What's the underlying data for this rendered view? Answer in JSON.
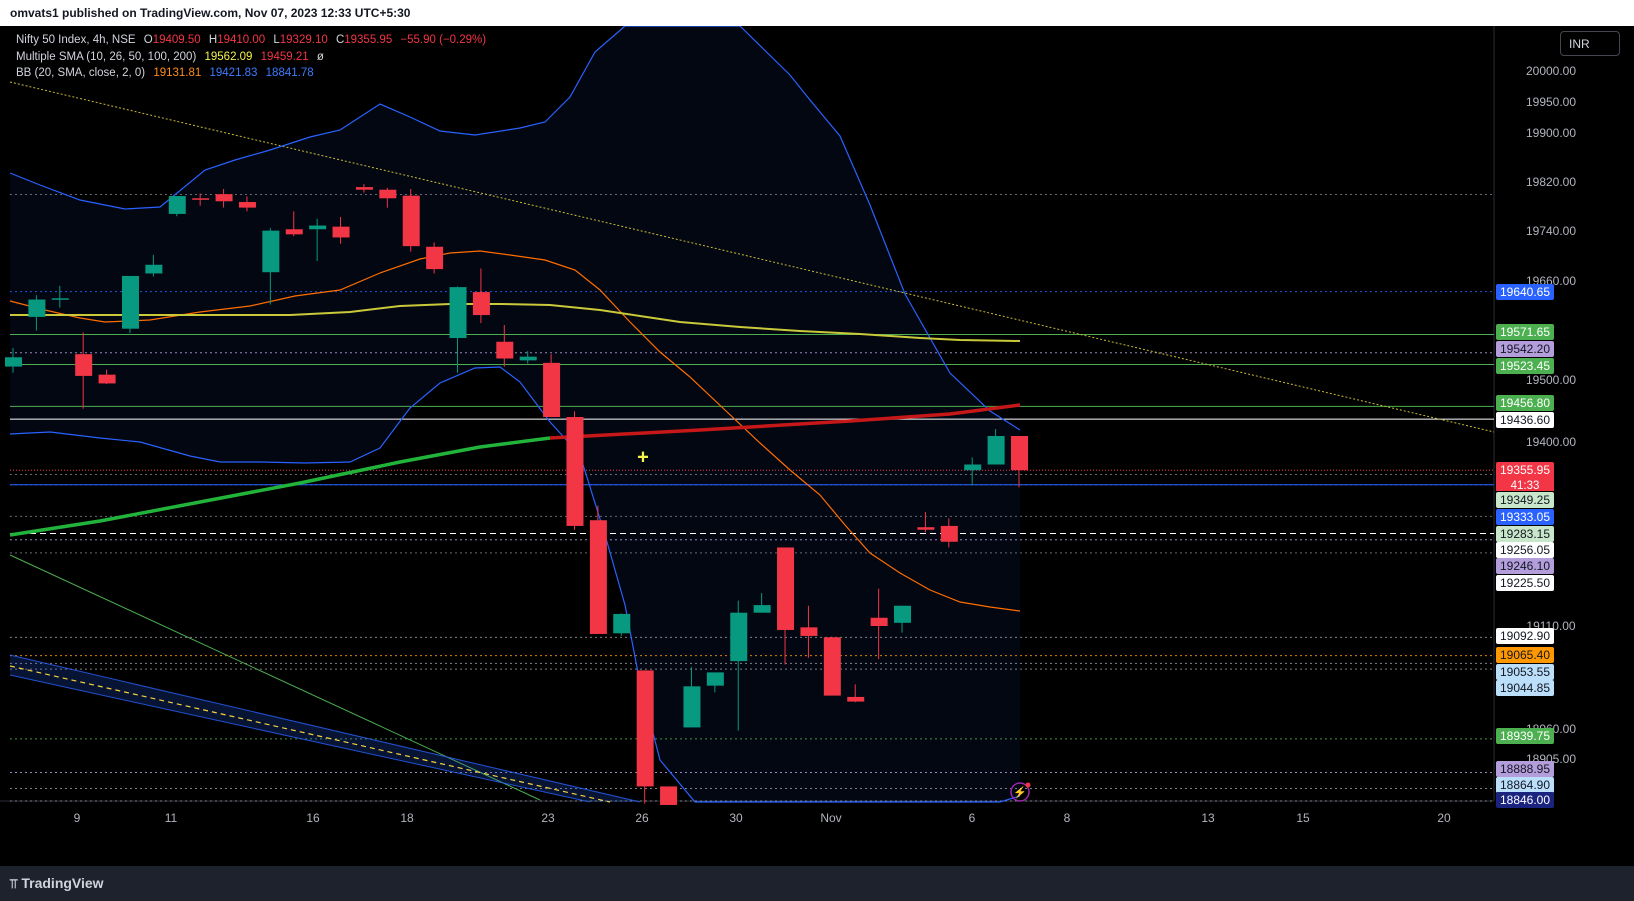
{
  "header": {
    "published": "omvats1 published on TradingView.com, Nov 07, 2023 12:33 UTC+5:30"
  },
  "currency_button": "INR",
  "footer": {
    "logo": "TradingView"
  },
  "legend": {
    "symbol": "Nifty 50 Index, 4h, NSE",
    "o_label": "O",
    "o": "19409.50",
    "h_label": "H",
    "h": "19410.00",
    "l_label": "L",
    "l": "19329.10",
    "c_label": "C",
    "c": "19355.95",
    "change": "−55.90 (−0.29%)",
    "sma_title": "Multiple SMA (10, 26, 50, 100, 200)",
    "sma_v1": "19562.09",
    "sma_v2": "19459.21",
    "sma_v3": "ø",
    "bb_title": "BB (20, SMA, close, 2, 0)",
    "bb_basis": "19131.81",
    "bb_upper": "19421.83",
    "bb_lower": "18841.78"
  },
  "chart_data": {
    "type": "candlestick",
    "title": "Nifty 50 Index, 4h, NSE",
    "x_tick_labels": [
      "9",
      "11",
      "16",
      "18",
      "23",
      "26",
      "30",
      "Nov",
      "6",
      "8",
      "13",
      "15",
      "20"
    ],
    "y_tick_labels": [
      "20000.00",
      "19950.00",
      "19900.00",
      "19820.00",
      "19740.00",
      "19660.00",
      "19500.00",
      "19400.00",
      "19110.00",
      "18960.00",
      "18905.00"
    ],
    "ylim": [
      18846,
      20040
    ],
    "candles": [
      {
        "o": 19520,
        "h": 19550,
        "l": 19510,
        "c": 19535
      },
      {
        "o": 19600,
        "h": 19635,
        "l": 19578,
        "c": 19628
      },
      {
        "o": 19630,
        "h": 19650,
        "l": 19615,
        "c": 19630
      },
      {
        "o": 19540,
        "h": 19575,
        "l": 19453,
        "c": 19505
      },
      {
        "o": 19507,
        "h": 19515,
        "l": 19492,
        "c": 19493
      },
      {
        "o": 19581,
        "h": 19665,
        "l": 19574,
        "c": 19666
      },
      {
        "o": 19670,
        "h": 19700,
        "l": 19665,
        "c": 19684
      },
      {
        "o": 19783,
        "h": 19830,
        "l": 19777,
        "c": 19831
      },
      {
        "o": 19825,
        "h": 19838,
        "l": 19805,
        "c": 19822
      },
      {
        "o": 19836,
        "h": 19850,
        "l": 19800,
        "c": 19817
      },
      {
        "o": 19815,
        "h": 19830,
        "l": 19790,
        "c": 19800
      },
      {
        "o": 19672,
        "h": 19745,
        "l": 19620,
        "c": 19739
      },
      {
        "o": 19742,
        "h": 19790,
        "l": 19730,
        "c": 19733
      },
      {
        "o": 19742,
        "h": 19770,
        "l": 19690,
        "c": 19752
      },
      {
        "o": 19749,
        "h": 19775,
        "l": 19718,
        "c": 19728
      },
      {
        "o": 19855,
        "h": 19863,
        "l": 19840,
        "c": 19848
      },
      {
        "o": 19848,
        "h": 19853,
        "l": 19800,
        "c": 19825
      },
      {
        "o": 19832,
        "h": 19850,
        "l": 19705,
        "c": 19714
      },
      {
        "o": 19713,
        "h": 19720,
        "l": 19670,
        "c": 19677
      },
      {
        "o": 19566,
        "h": 19649,
        "l": 19510,
        "c": 19648
      },
      {
        "o": 19640,
        "h": 19678,
        "l": 19590,
        "c": 19603
      },
      {
        "o": 19560,
        "h": 19587,
        "l": 19520,
        "c": 19533
      },
      {
        "o": 19530,
        "h": 19545,
        "l": 19525,
        "c": 19536
      },
      {
        "o": 19526,
        "h": 19540,
        "l": 19440,
        "c": 19440
      },
      {
        "o": 19440,
        "h": 19449,
        "l": 19262,
        "c": 19268
      },
      {
        "o": 19277,
        "h": 19300,
        "l": 19098,
        "c": 19098
      },
      {
        "o": 19099,
        "h": 19130,
        "l": 19095,
        "c": 19129
      },
      {
        "o": 19043,
        "h": 19043,
        "l": 18842,
        "c": 18868
      },
      {
        "o": 18868,
        "h": 18868,
        "l": 18840,
        "c": 18840
      },
      {
        "o": 18957,
        "h": 19048,
        "l": 18957,
        "c": 19019
      },
      {
        "o": 19020,
        "h": 19040,
        "l": 19010,
        "c": 19040
      },
      {
        "o": 19057,
        "h": 19150,
        "l": 18952,
        "c": 19131
      },
      {
        "o": 19131,
        "h": 19162,
        "l": 19131,
        "c": 19143
      },
      {
        "o": 19234,
        "h": 19234,
        "l": 19052,
        "c": 19104
      },
      {
        "o": 19108,
        "h": 19142,
        "l": 19062,
        "c": 19095
      },
      {
        "o": 19093,
        "h": 19094,
        "l": 19005,
        "c": 19005
      },
      {
        "o": 19003,
        "h": 19022,
        "l": 18995,
        "c": 18996
      },
      {
        "o": 19123,
        "h": 19169,
        "l": 19060,
        "c": 19110
      },
      {
        "o": 19115,
        "h": 19142,
        "l": 19100,
        "c": 19142
      },
      {
        "o": 19266,
        "h": 19290,
        "l": 19258,
        "c": 19262
      },
      {
        "o": 19268,
        "h": 19280,
        "l": 19234,
        "c": 19243
      },
      {
        "o": 19356,
        "h": 19376,
        "l": 19332,
        "c": 19365
      },
      {
        "o": 19365,
        "h": 19421,
        "l": 19365,
        "c": 19410
      },
      {
        "o": 19410,
        "h": 19410,
        "l": 19329,
        "c": 19356
      }
    ],
    "price_labels": [
      {
        "value": "19640.65",
        "bg": "#2962ff",
        "fg": "#ffffff"
      },
      {
        "value": "19571.65",
        "bg": "#4caf50",
        "fg": "#ffffff"
      },
      {
        "value": "19542.20",
        "bg": "#b39ddb",
        "fg": "#131722"
      },
      {
        "value": "19523.45",
        "bg": "#4caf50",
        "fg": "#ffffff"
      },
      {
        "value": "19456.80",
        "bg": "#4caf50",
        "fg": "#ffffff"
      },
      {
        "value": "19436.60",
        "bg": "#ffffff",
        "fg": "#131722"
      },
      {
        "value": "19355.95",
        "bg": "#f23645",
        "fg": "#ffffff"
      },
      {
        "value": "19349.25",
        "bg": "#c8e6c9",
        "fg": "#131722"
      },
      {
        "value": "19333.05",
        "bg": "#2962ff",
        "fg": "#ffffff"
      },
      {
        "value": "19283.15",
        "bg": "#c8e6c9",
        "fg": "#131722"
      },
      {
        "value": "19256.05",
        "bg": "#ffffff",
        "fg": "#131722"
      },
      {
        "value": "19246.10",
        "bg": "#b39ddb",
        "fg": "#131722"
      },
      {
        "value": "19225.50",
        "bg": "#ffffff",
        "fg": "#131722"
      },
      {
        "value": "19092.90",
        "bg": "#ffffff",
        "fg": "#131722"
      },
      {
        "value": "19065.40",
        "bg": "#ff9800",
        "fg": "#131722"
      },
      {
        "value": "19053.55",
        "bg": "#bbdefb",
        "fg": "#131722"
      },
      {
        "value": "19044.85",
        "bg": "#bbdefb",
        "fg": "#131722"
      },
      {
        "value": "18939.75",
        "bg": "#4caf50",
        "fg": "#ffffff"
      },
      {
        "value": "18888.95",
        "bg": "#b39ddb",
        "fg": "#131722"
      },
      {
        "value": "18864.90",
        "bg": "#bbdefb",
        "fg": "#131722"
      },
      {
        "value": "18846.00",
        "bg": "#1a237e",
        "fg": "#ffffff"
      }
    ],
    "countdown": "41:33",
    "colors": {
      "up": "#089981",
      "down": "#f23645",
      "bb": "#2962ff",
      "bb_basis": "#ff6d00",
      "sma_100": "#c9c93a",
      "sma_200_below": "#22b33a",
      "sma_200_above": "#c61818"
    }
  }
}
